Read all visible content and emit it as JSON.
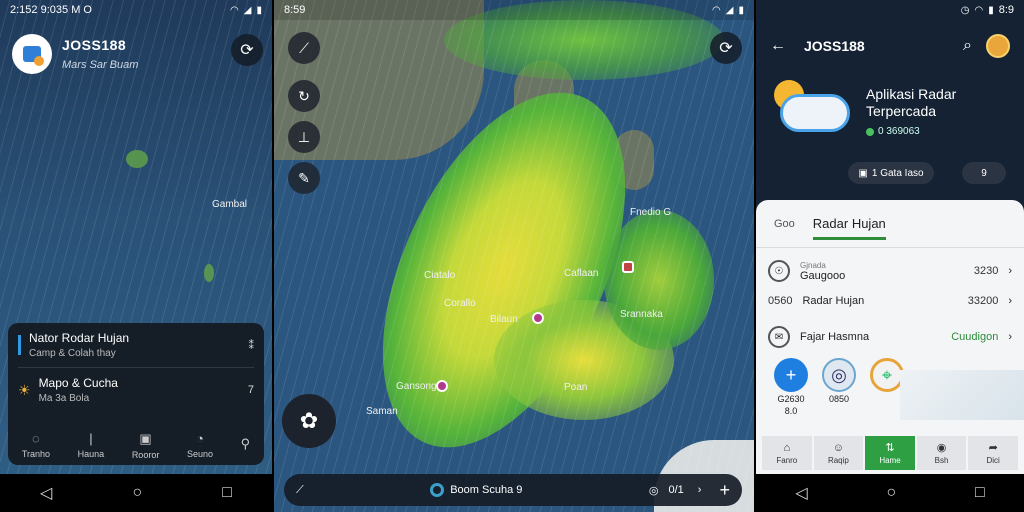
{
  "status": {
    "left_time": "2:152 9:035",
    "left_extra": "M O",
    "mid_time": "8:59",
    "right_time": "8:9"
  },
  "panel1": {
    "app_name": "JOSS188",
    "subtitle": "Mars Sar Buam",
    "map_label": "Gambal",
    "card": {
      "row1_title": "Nator Rodar Hujan",
      "row1_sub": "Camp & Colah thay",
      "row1_right": "⁑",
      "row2_title": "Mapo & Cucha",
      "row2_sub": "Ma 3a Bola",
      "row2_right": "7"
    },
    "tabs": [
      {
        "icon": "chat-icon",
        "glyph": "◌",
        "label": "Tranho"
      },
      {
        "icon": "pipe-icon",
        "glyph": "|",
        "label": "Hauna"
      },
      {
        "icon": "grid-icon",
        "glyph": "▣",
        "label": "Rooror"
      },
      {
        "icon": "compass-icon",
        "glyph": "◔",
        "label": "Seuno"
      },
      {
        "icon": "share-icon",
        "glyph": "⚲",
        "label": ""
      }
    ]
  },
  "panel2": {
    "labels": [
      {
        "text": "Fnedio G",
        "x": "cap"
      },
      {
        "text": "Ciatalo"
      },
      {
        "text": "Corallo"
      },
      {
        "text": "Caflaan"
      },
      {
        "text": "Bilaun"
      },
      {
        "text": "Srannaka"
      },
      {
        "text": "Gansong"
      },
      {
        "text": "Poan"
      },
      {
        "text": "Saman"
      }
    ],
    "bottom_text": "Boom Scuha 9",
    "bottom_value": "0/1",
    "plus": "+"
  },
  "panel3": {
    "title": "JOSS188",
    "hero_title_line1": "Aplikasi Radar",
    "hero_title_line2": "Terpercada",
    "hero_badge": "0 369063",
    "chip1": "1 Gata Iaso",
    "chip2": "9",
    "sheet_tab_key": "Goo",
    "sheet_tab": "Radar Hujan",
    "rows": [
      {
        "title": "Gaugooo",
        "sub": "Gjnada",
        "value": "3230"
      },
      {
        "title": "Radar Hujan",
        "key": "0560",
        "value": "33200"
      },
      {
        "title": "Fajar Hasmna",
        "value": "Cuudigon"
      }
    ],
    "quick": [
      {
        "label": "G2630",
        "sub": "8.0"
      },
      {
        "label": "0850",
        "sub": ""
      },
      {
        "label": "",
        "sub": ""
      }
    ],
    "tabs": [
      {
        "label": "Fanro",
        "glyph": "⌂"
      },
      {
        "label": "Raqip",
        "glyph": "☺"
      },
      {
        "label": "Hame",
        "glyph": "⇅"
      },
      {
        "label": "Bsh",
        "glyph": "◉"
      },
      {
        "label": "Dici",
        "glyph": "➦"
      }
    ]
  }
}
